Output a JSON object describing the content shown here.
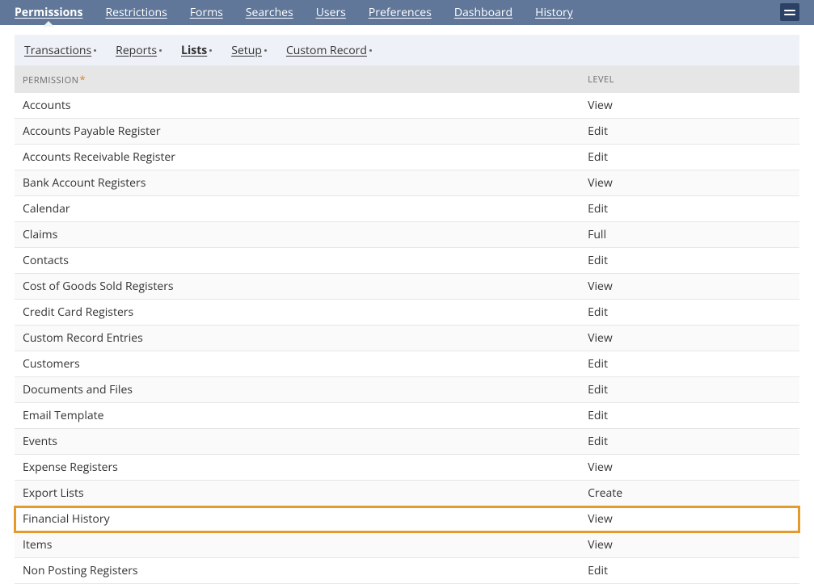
{
  "mainTabs": [
    {
      "label": "Permissions",
      "active": true
    },
    {
      "label": "Restrictions",
      "active": false
    },
    {
      "label": "Forms",
      "active": false
    },
    {
      "label": "Searches",
      "active": false
    },
    {
      "label": "Users",
      "active": false
    },
    {
      "label": "Preferences",
      "active": false
    },
    {
      "label": "Dashboard",
      "active": false
    },
    {
      "label": "History",
      "active": false
    }
  ],
  "subTabs": [
    {
      "label": "Transactions",
      "active": false
    },
    {
      "label": "Reports",
      "active": false
    },
    {
      "label": "Lists",
      "active": true
    },
    {
      "label": "Setup",
      "active": false
    },
    {
      "label": "Custom Record",
      "active": false
    }
  ],
  "columns": {
    "permission": "PERMISSION",
    "level": "LEVEL"
  },
  "rows": [
    {
      "permission": "Accounts",
      "level": "View"
    },
    {
      "permission": "Accounts Payable Register",
      "level": "Edit"
    },
    {
      "permission": "Accounts Receivable Register",
      "level": "Edit"
    },
    {
      "permission": "Bank Account Registers",
      "level": "View"
    },
    {
      "permission": "Calendar",
      "level": "Edit"
    },
    {
      "permission": "Claims",
      "level": "Full"
    },
    {
      "permission": "Contacts",
      "level": "Edit"
    },
    {
      "permission": "Cost of Goods Sold Registers",
      "level": "View"
    },
    {
      "permission": "Credit Card Registers",
      "level": "Edit"
    },
    {
      "permission": "Custom Record Entries",
      "level": "View"
    },
    {
      "permission": "Customers",
      "level": "Edit"
    },
    {
      "permission": "Documents and Files",
      "level": "Edit"
    },
    {
      "permission": "Email Template",
      "level": "Edit"
    },
    {
      "permission": "Events",
      "level": "Edit"
    },
    {
      "permission": "Expense Registers",
      "level": "View"
    },
    {
      "permission": "Export Lists",
      "level": "Create"
    },
    {
      "permission": "Financial History",
      "level": "View",
      "highlight": true
    },
    {
      "permission": "Items",
      "level": "View"
    },
    {
      "permission": "Non Posting Registers",
      "level": "Edit"
    }
  ]
}
